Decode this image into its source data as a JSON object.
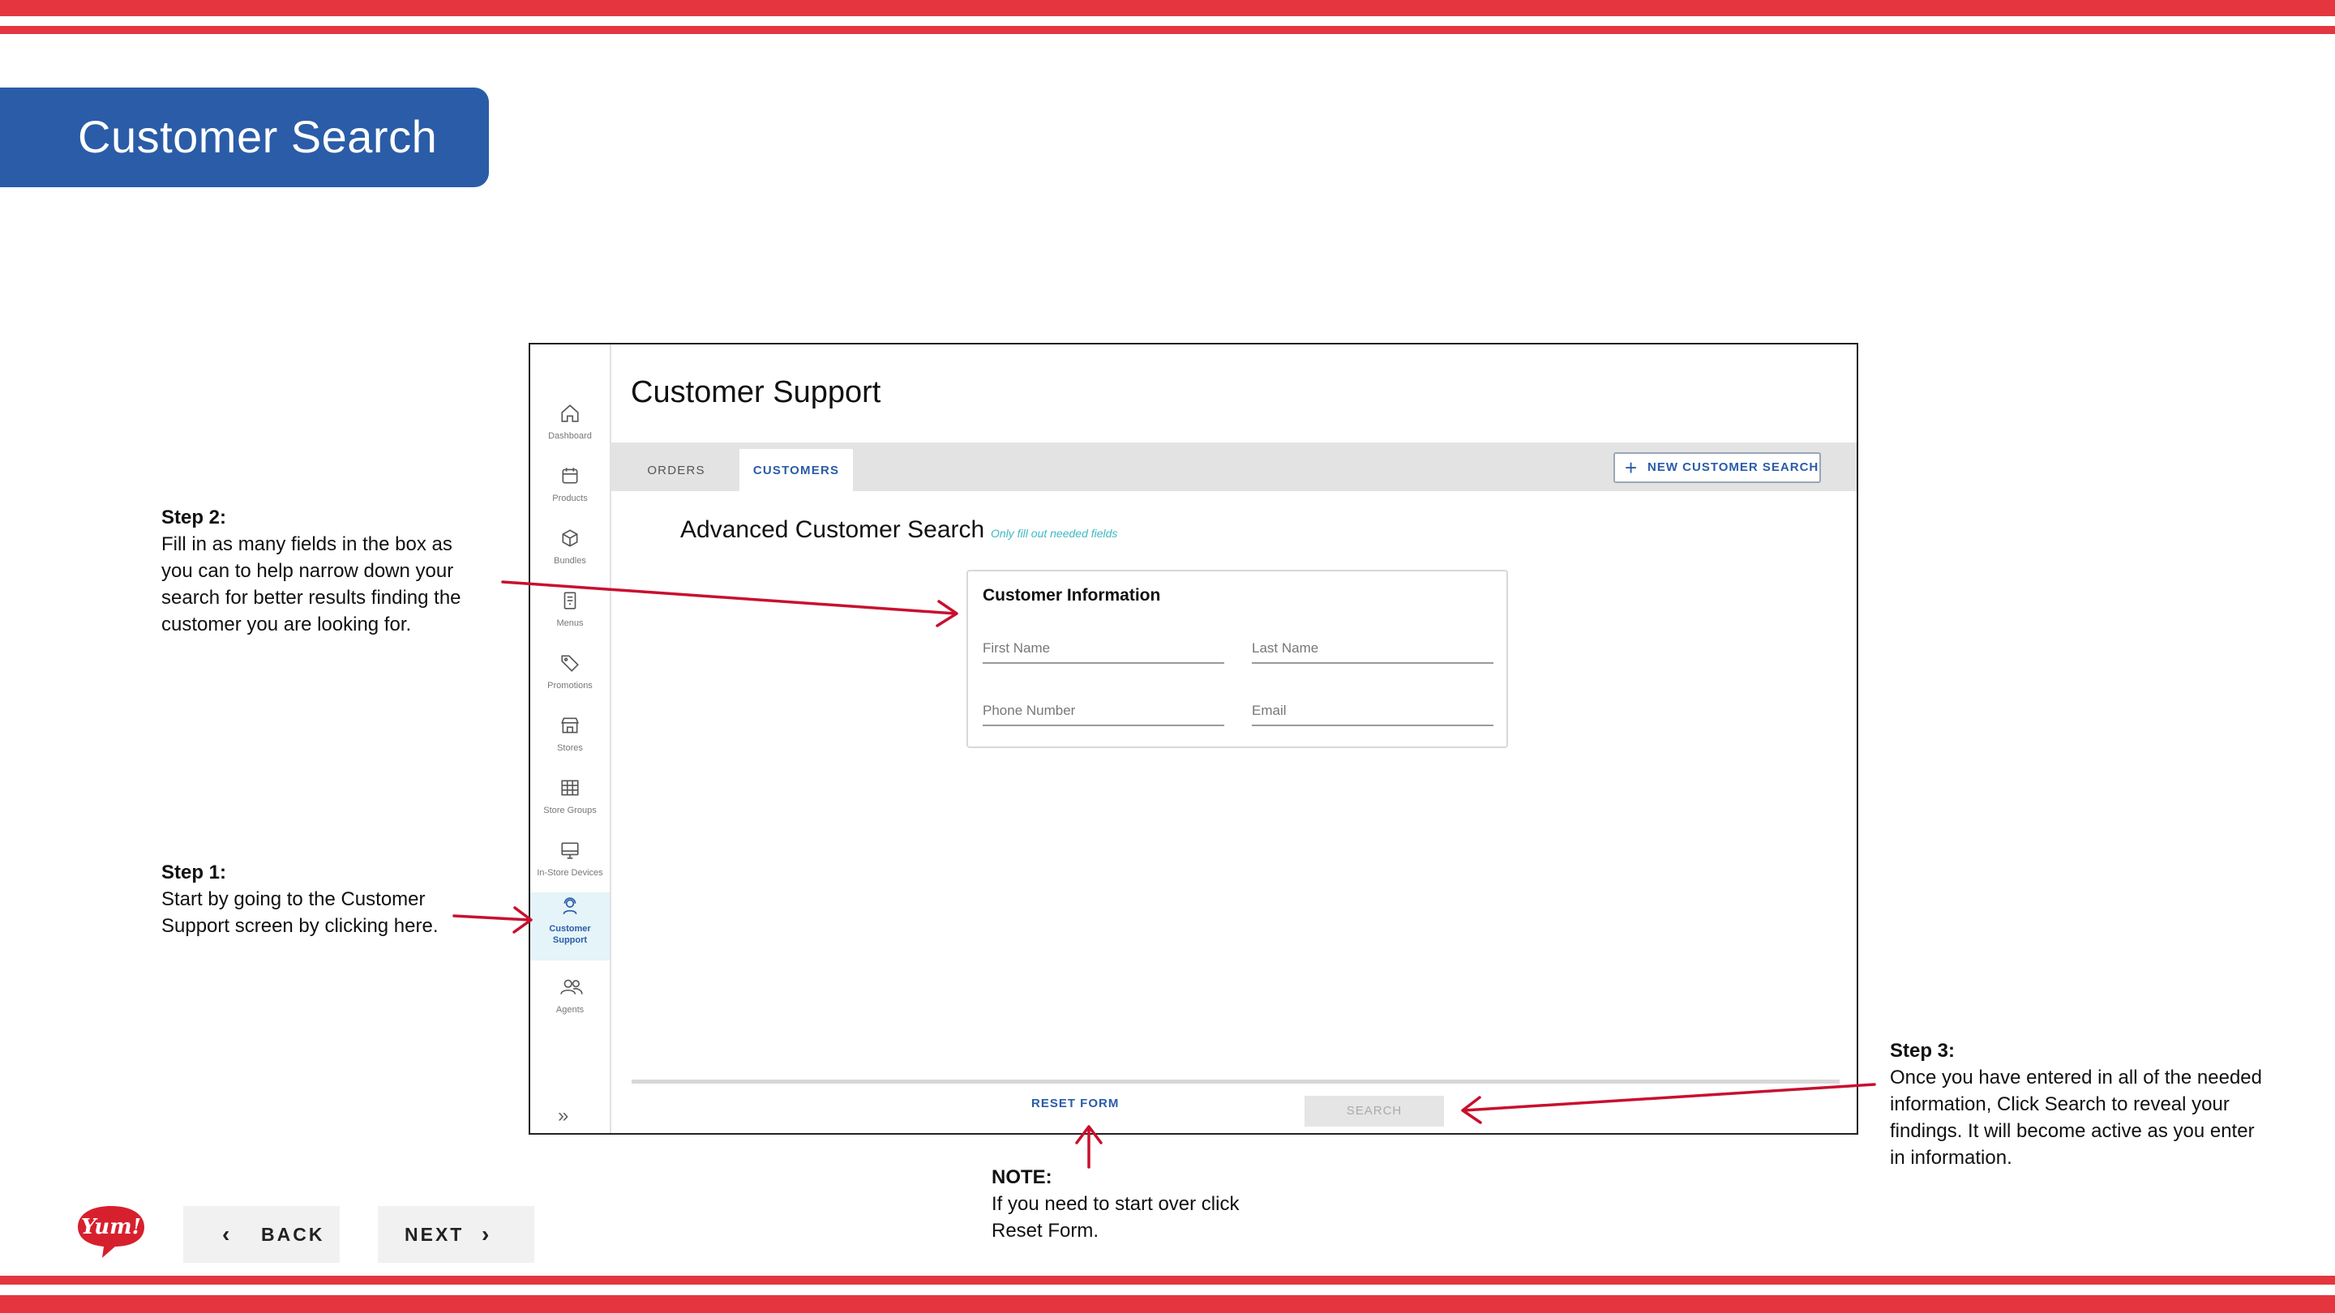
{
  "slide": {
    "title": "Customer Search",
    "back_label": "BACK",
    "next_label": "NEXT",
    "logo_text": "Yum!"
  },
  "app": {
    "page_title": "Customer Support",
    "sidebar": [
      {
        "label": "Dashboard",
        "icon": "home-icon"
      },
      {
        "label": "Products",
        "icon": "calendar-icon"
      },
      {
        "label": "Bundles",
        "icon": "box-icon"
      },
      {
        "label": "Menus",
        "icon": "menu-doc-icon"
      },
      {
        "label": "Promotions",
        "icon": "tag-icon"
      },
      {
        "label": "Stores",
        "icon": "store-icon"
      },
      {
        "label": "Store Groups",
        "icon": "grid-icon"
      },
      {
        "label": "In-Store Devices",
        "icon": "monitor-icon"
      },
      {
        "label_line1": "Customer",
        "label_line2": "Support",
        "icon": "support-agent-icon",
        "active": true
      },
      {
        "label": "Agents",
        "icon": "users-icon"
      }
    ],
    "tabs": [
      {
        "label": "ORDERS"
      },
      {
        "label": "CUSTOMERS",
        "active": true
      }
    ],
    "new_search_label": "NEW CUSTOMER SEARCH",
    "advanced_title": "Advanced Customer Search",
    "advanced_hint": "Only fill out needed fields",
    "card_title": "Customer Information",
    "fields": {
      "first_name": "First Name",
      "last_name": "Last Name",
      "phone": "Phone Number",
      "email": "Email"
    },
    "reset_label": "RESET FORM",
    "search_label": "SEARCH"
  },
  "annotations": {
    "step1_title": "Step 1:",
    "step1_lines": [
      "Start by going to the Customer",
      "Support screen by clicking here."
    ],
    "step2_title": "Step 2:",
    "step2_lines": [
      "Fill in as many fields in the box as",
      "you can to help narrow down your",
      "search for better results finding the",
      "customer you are looking for."
    ],
    "step3_title": "Step 3:",
    "step3_lines": [
      "Once you have entered in all of the needed",
      "information, Click Search to reveal your",
      "findings. It will become active as you enter",
      "in information."
    ],
    "note_title": "NOTE:",
    "note_lines": [
      "If you need to start over click",
      "Reset Form."
    ]
  },
  "colors": {
    "brand_red": "#e4363f",
    "brand_blue": "#2a5ca8",
    "hint_teal": "#3fb8c2",
    "arrow_red": "#c8102e"
  }
}
